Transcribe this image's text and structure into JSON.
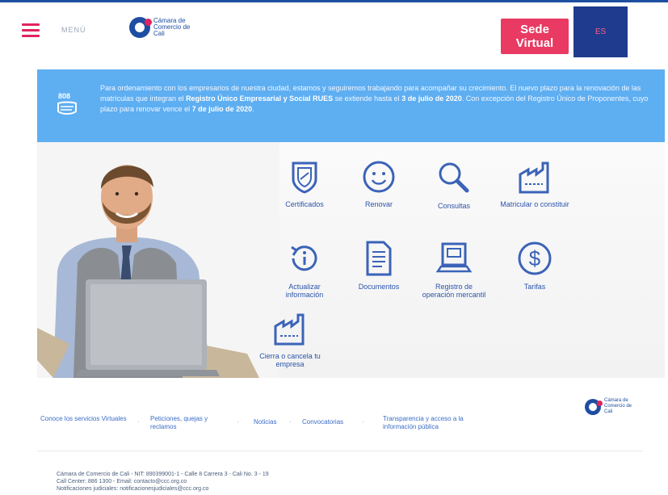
{
  "header": {
    "menu_label": "MENÚ",
    "logo_text": "Cámara de Comercio de Cali",
    "sede_virtual": "Sede Virtual",
    "lang_label": "ES"
  },
  "banner": {
    "text_1": "Para ordenamiento con los empresarios de nuestra ciudad, estamos y seguiremos trabajando para acompañar su crecimiento. El nuevo plazo para la renovación de las matrículas que integran el ",
    "bold_1": "Registro Único Empresarial y Social RUES",
    "text_2": " se extiende hasta el ",
    "bold_2": "3 de julio de 2020",
    "text_3": ". Con excepción del Registro Único de Proponentes, cuyo plazo para renovar vence el ",
    "bold_3": "7 de julio de 2020",
    "text_4": "."
  },
  "tiles": [
    {
      "label": "Certificados",
      "icon": "shield-certificate-icon"
    },
    {
      "label": "Renovar",
      "icon": "smiley-icon"
    },
    {
      "label": "Consultas",
      "icon": "magnifier-icon"
    },
    {
      "label": "Matricular o constituir",
      "icon": "factory-icon"
    },
    {
      "label": "Actualizar información",
      "icon": "history-info-icon"
    },
    {
      "label": "Documentos",
      "icon": "document-icon"
    },
    {
      "label": "Registro de operación mercantil",
      "icon": "computer-icon"
    },
    {
      "label": "Tarifas",
      "icon": "dollar-icon"
    },
    {
      "label": "Cierra o cancela tu empresa",
      "icon": "factory-icon"
    }
  ],
  "footer": {
    "links": [
      "Conoce los servicios Virtuales",
      "Peticiones, quejas y reclamos",
      "Noticias",
      "Convocatorias",
      "Transparencia y acceso a la información pública"
    ],
    "logo_text": "Cámara de Comercio de Cali",
    "legal_line_1": "Cámara de Comercio de Cali - NIT: 890399001-1 - Calle 8 Carrera 3 - Cali No. 3 - 19",
    "legal_line_2": "Call Center: 886 1300 - Email: contacto@ccc.org.co",
    "legal_line_3": "Notificaciones judiciales: notificacionesjudiciales@ccc.org.co"
  },
  "colors": {
    "primary": "#1e4ea1",
    "accent": "#e83a62",
    "banner": "#5eaef2",
    "icon": "#3b63b8"
  }
}
